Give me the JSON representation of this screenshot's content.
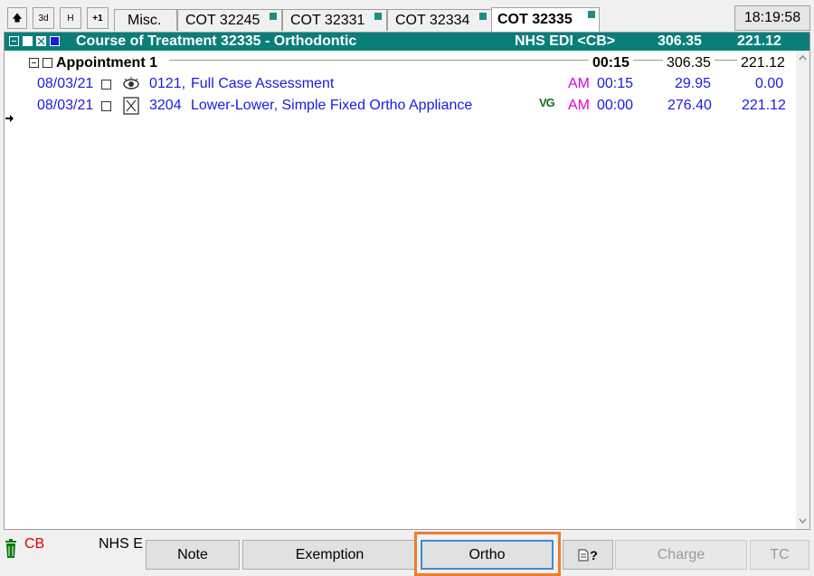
{
  "toolbar": {
    "up_label": "🡅",
    "three_d_label": "3d",
    "h_label": "H",
    "plus_one_label": "+1"
  },
  "tabs": [
    {
      "label": "Misc.",
      "marker": false,
      "active": false
    },
    {
      "label": "COT 32245",
      "marker": true,
      "active": false
    },
    {
      "label": "COT 32331",
      "marker": true,
      "active": false
    },
    {
      "label": "COT 32334",
      "marker": true,
      "active": false
    },
    {
      "label": "COT 32335",
      "marker": true,
      "active": true
    }
  ],
  "clock": "18:19:58",
  "course": {
    "title": "Course of Treatment 32335 - Orthodontic",
    "claim": "NHS EDI <CB>",
    "total": "306.35",
    "charge": "221.12",
    "header_color": "#0b7e7a"
  },
  "appointment": {
    "label": "Appointment 1",
    "time": "00:15",
    "total": "306.35",
    "charge": "221.12"
  },
  "items": [
    {
      "date": "08/03/21",
      "icon": "eye-icon",
      "code": "0121,",
      "desc": "Full Case Assessment",
      "period": "AM",
      "time": "00:15",
      "total": "29.95",
      "charge": "0.00",
      "badge": ""
    },
    {
      "date": "08/03/21",
      "icon": "appliance-icon",
      "code": "3204",
      "desc": "Lower-Lower, Simple Fixed Ortho Appliance",
      "period": "AM",
      "time": "00:00",
      "total": "276.40",
      "charge": "221.12",
      "badge": "VG"
    }
  ],
  "status": {
    "code": "CB",
    "code_color": "#e00000",
    "exemption_text": "NHS E"
  },
  "buttons": {
    "note": "Note",
    "exemption": "Exemption",
    "ortho": "Ortho",
    "help": "?",
    "charge": "Charge",
    "tc": "TC"
  },
  "highlight_color": "#f07c2a"
}
